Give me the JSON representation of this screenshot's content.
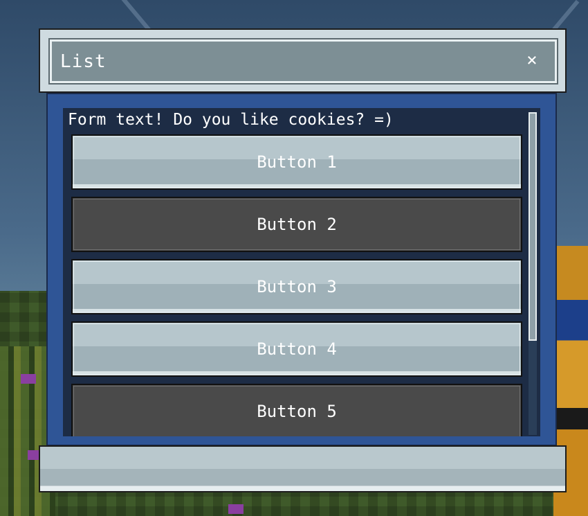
{
  "window": {
    "title": "List",
    "close_glyph": "×"
  },
  "form": {
    "text": "Form text! Do you like cookies? =)",
    "buttons": [
      {
        "label": "Button 1",
        "style": "light"
      },
      {
        "label": "Button 2",
        "style": "dark"
      },
      {
        "label": "Button 3",
        "style": "light"
      },
      {
        "label": "Button 4",
        "style": "light"
      },
      {
        "label": "Button 5",
        "style": "dark"
      }
    ]
  },
  "colors": {
    "title_bar": "#7d8f95",
    "dialog_body": "#2f5596",
    "content_bg": "#1d2c45",
    "button_light": "#b6c6cc",
    "button_dark": "#4a4a4a",
    "text": "#ffffff"
  }
}
